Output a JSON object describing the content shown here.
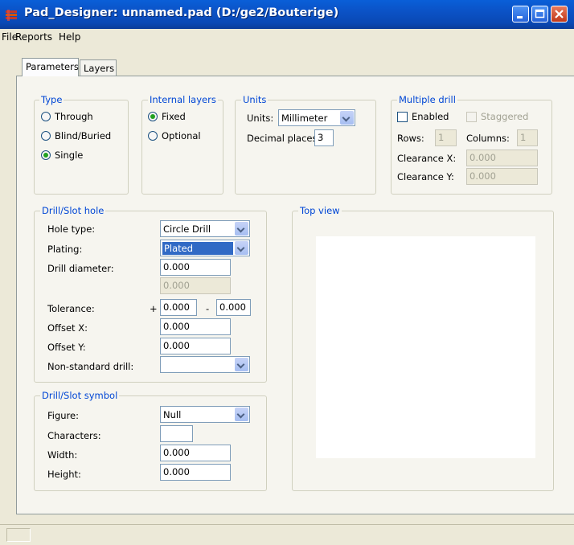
{
  "window": {
    "title": "Pad_Designer: unnamed.pad (D:/ge2/Bouterige)",
    "icon": "pad-designer-app-icon",
    "colors": {
      "titlebar": "#0b52c6",
      "legend": "#0046d5",
      "selection": "#316ac5"
    }
  },
  "menu": {
    "file": "File",
    "reports": "Reports",
    "help": "Help"
  },
  "tabs": {
    "parameters": "Parameters",
    "layers": "Layers",
    "active": "Parameters"
  },
  "type_group": {
    "legend": "Type",
    "through": "Through",
    "blind_buried": "Blind/Buried",
    "single": "Single",
    "selected": "Single"
  },
  "internal_layers": {
    "legend": "Internal layers",
    "fixed": "Fixed",
    "optional": "Optional",
    "selected": "Fixed"
  },
  "units": {
    "legend": "Units",
    "units_label": "Units:",
    "units_value": "Millimeter",
    "decimal_label": "Decimal places:",
    "decimal_value": "3"
  },
  "multiple_drill": {
    "legend": "Multiple drill",
    "enabled_label": "Enabled",
    "enabled": false,
    "staggered_label": "Staggered",
    "staggered": false,
    "rows_label": "Rows:",
    "rows_value": "1",
    "columns_label": "Columns:",
    "columns_value": "1",
    "clearance_x_label": "Clearance X:",
    "clearance_x_value": "0.000",
    "clearance_y_label": "Clearance Y:",
    "clearance_y_value": "0.000"
  },
  "drill_slot_hole": {
    "legend": "Drill/Slot hole",
    "hole_type_label": "Hole type:",
    "hole_type_value": "Circle Drill",
    "plating_label": "Plating:",
    "plating_value": "Plated",
    "drill_diameter_label": "Drill diameter:",
    "drill_diameter_value": "0.000",
    "secondary_value": "0.000",
    "tolerance_label": "Tolerance:",
    "tolerance_plus_sign": "+",
    "tolerance_plus_value": "0.000",
    "tolerance_minus_sign": "-",
    "tolerance_minus_value": "0.000",
    "offset_x_label": "Offset X:",
    "offset_x_value": "0.000",
    "offset_y_label": "Offset Y:",
    "offset_y_value": "0.000",
    "non_standard_label": "Non-standard drill:",
    "non_standard_value": ""
  },
  "drill_slot_symbol": {
    "legend": "Drill/Slot symbol",
    "figure_label": "Figure:",
    "figure_value": "Null",
    "characters_label": "Characters:",
    "characters_value": "",
    "width_label": "Width:",
    "width_value": "0.000",
    "height_label": "Height:",
    "height_value": "0.000"
  },
  "top_view": {
    "legend": "Top view"
  }
}
